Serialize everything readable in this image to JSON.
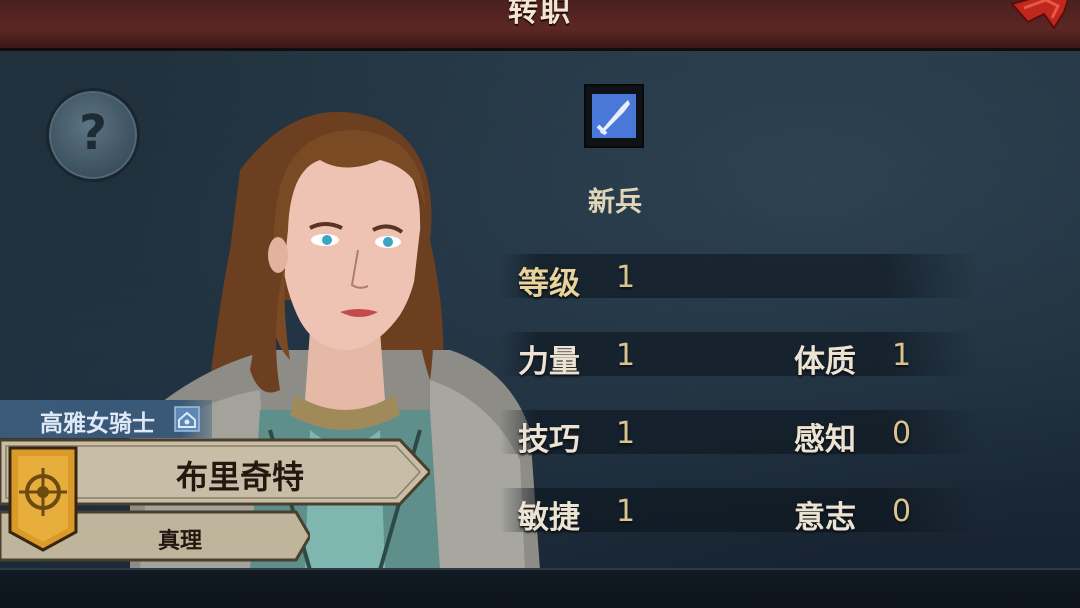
{
  "header": {
    "title": "转职"
  },
  "class_info": {
    "icon": "sword-icon",
    "name": "新兵"
  },
  "stats": {
    "level": {
      "label": "等级",
      "value": "1"
    },
    "strength": {
      "label": "力量",
      "value": "1"
    },
    "constitution": {
      "label": "体质",
      "value": "1"
    },
    "skill": {
      "label": "技巧",
      "value": "1"
    },
    "perception": {
      "label": "感知",
      "value": "0"
    },
    "agility": {
      "label": "敏捷",
      "value": "1"
    },
    "willpower": {
      "label": "意志",
      "value": "0"
    }
  },
  "character": {
    "title": "高雅女骑士",
    "name": "布里奇特",
    "faction": "真理"
  },
  "colors": {
    "header_bg": "#5b2724",
    "accent_gold": "#d9c48e",
    "title_tag_blue": "#3a5878",
    "parchment": "#c9bfa9"
  }
}
